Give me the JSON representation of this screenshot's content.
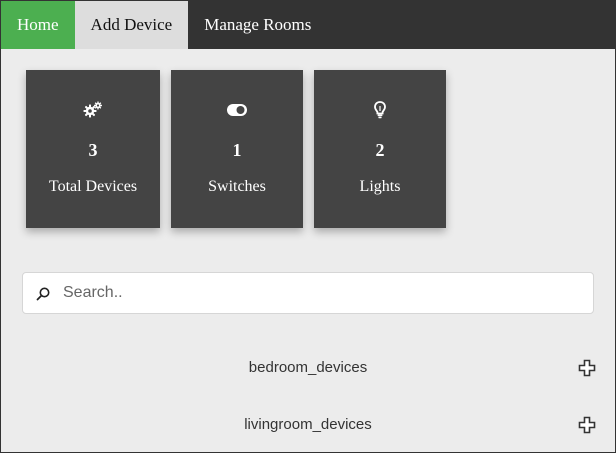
{
  "nav": {
    "home": "Home",
    "add_device": "Add Device",
    "manage_rooms": "Manage Rooms"
  },
  "stats": [
    {
      "icon": "gears-icon",
      "count": "3",
      "label": "Total Devices"
    },
    {
      "icon": "toggle-icon",
      "count": "1",
      "label": "Switches"
    },
    {
      "icon": "lightbulb-icon",
      "count": "2",
      "label": "Lights"
    }
  ],
  "search": {
    "placeholder": "Search..",
    "value": ""
  },
  "rooms": [
    {
      "name": "bedroom_devices",
      "action_icon": "plus-icon"
    },
    {
      "name": "livingroom_devices",
      "action_icon": "plus-icon"
    }
  ],
  "colors": {
    "nav_bg": "#333333",
    "home_active": "#4caf50",
    "add_device_bg": "#dddddd",
    "card_bg": "#444444",
    "page_bg": "#ececec"
  }
}
